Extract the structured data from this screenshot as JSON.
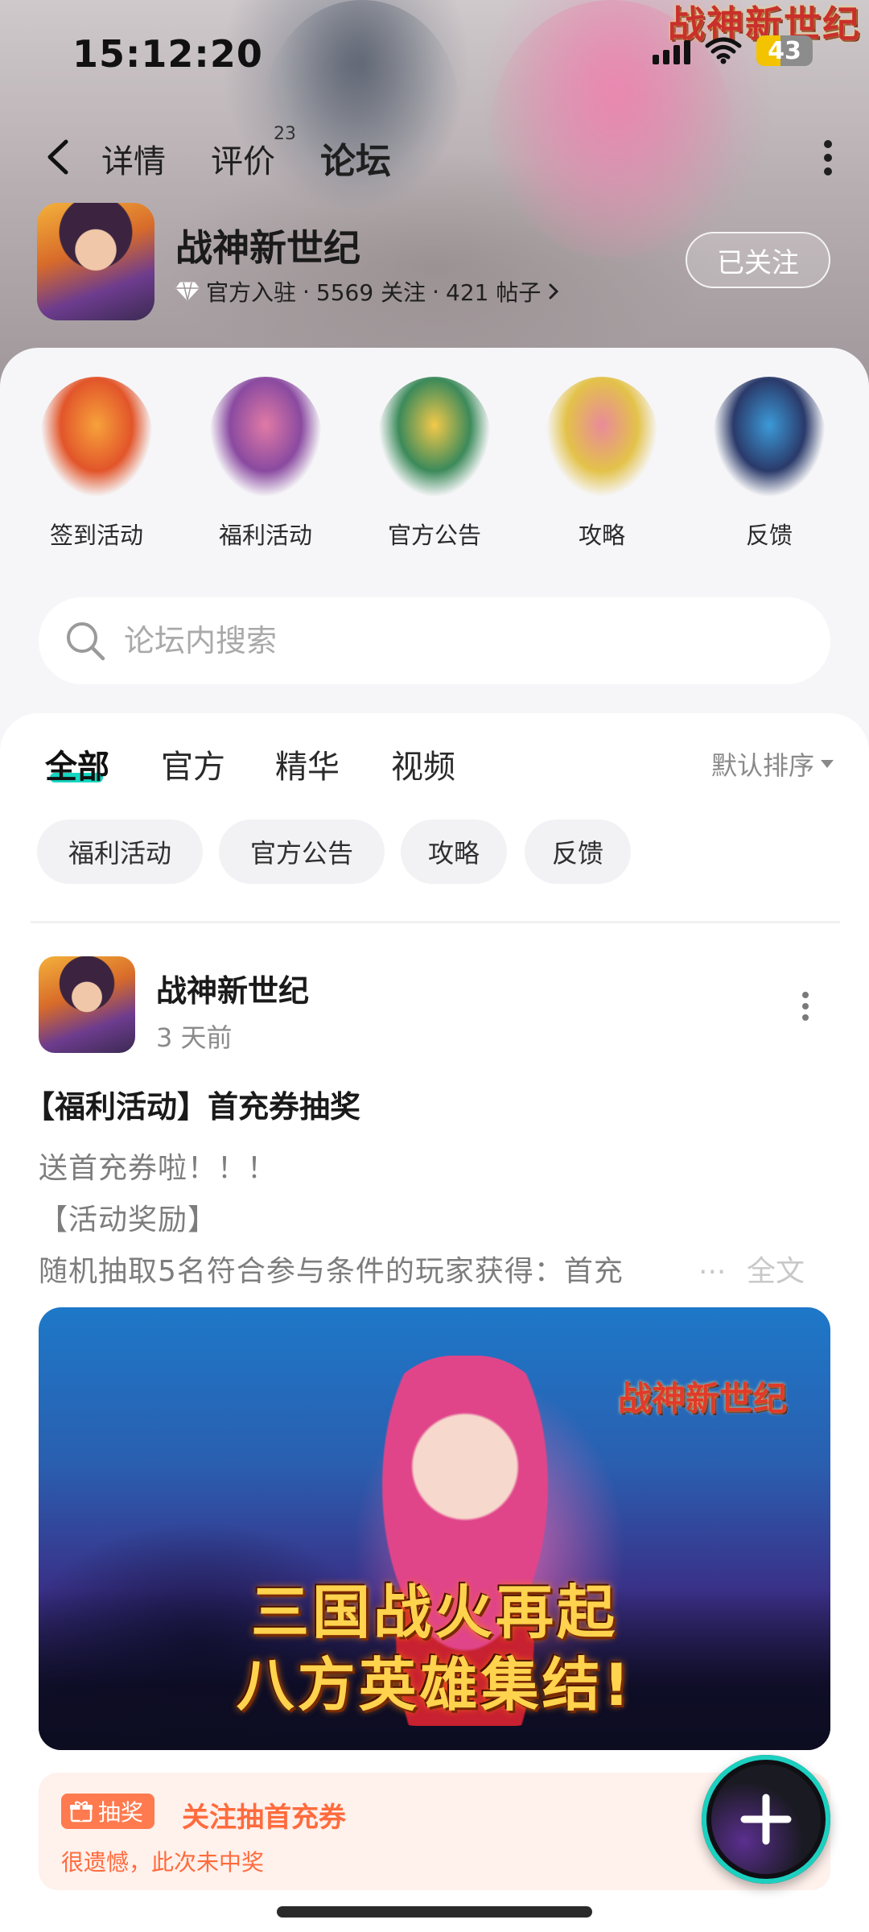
{
  "status_bar": {
    "time": "15:12:20",
    "battery": "43",
    "battery_level_percent": 43
  },
  "hero": {
    "logo_text": "战神新世纪"
  },
  "nav": {
    "tabs": [
      {
        "label": "详情"
      },
      {
        "label": "评价",
        "count": "23"
      },
      {
        "label": "论坛"
      }
    ]
  },
  "game": {
    "name": "战神新世纪",
    "badge": "官方入驻",
    "followers": "5569 关注",
    "posts": "421 帖子",
    "separator": "·",
    "follow_label": "已关注"
  },
  "categories": [
    {
      "label": "签到活动",
      "colors": [
        "#f7a23b",
        "#e2552a"
      ]
    },
    {
      "label": "福利活动",
      "colors": [
        "#e07aa6",
        "#8a4aa0"
      ]
    },
    {
      "label": "官方公告",
      "colors": [
        "#f3c94a",
        "#3c8a5a"
      ]
    },
    {
      "label": "攻略",
      "colors": [
        "#e98a9a",
        "#e3c24a"
      ]
    },
    {
      "label": "反馈",
      "colors": [
        "#3c9ad8",
        "#2a3a6a"
      ]
    }
  ],
  "search": {
    "placeholder": "论坛内搜索"
  },
  "feed_tabs": [
    "全部",
    "官方",
    "精华",
    "视频"
  ],
  "sort": {
    "label": "默认排序"
  },
  "chips": [
    "福利活动",
    "官方公告",
    "攻略",
    "反馈"
  ],
  "post": {
    "author": "战神新世纪",
    "time": "3 天前",
    "title": "【福利活动】首充券抽奖",
    "lines": [
      "送首充券啦！！！",
      "【活动奖励】",
      "随机抽取5名符合参与条件的玩家获得：首充"
    ],
    "ellipsis": "...",
    "full_text_label": "全文",
    "banner": {
      "logo": "战神新世纪",
      "line1": "三国战火再起",
      "line2": "八方英雄集结!"
    }
  },
  "lottery": {
    "tag": "抽奖",
    "title": "关注抽首充券",
    "result": "很遗憾，此次未中奖"
  },
  "colors": {
    "accent": "#15d6c0",
    "lottery": "#ff6b3d"
  }
}
